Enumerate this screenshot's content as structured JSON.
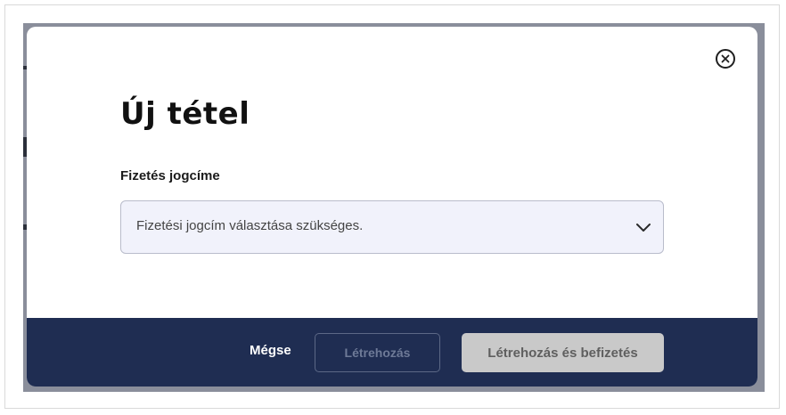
{
  "dialog": {
    "title": "Új tétel",
    "close_icon": "close-circle-icon"
  },
  "form": {
    "payment_title_label": "Fizetés jogcíme",
    "payment_title_select": {
      "placeholder": "Fizetési jogcím választása szükséges.",
      "icon": "chevron-down-icon"
    }
  },
  "footer": {
    "cancel_label": "Mégse",
    "create_label": "Létrehozás",
    "create_and_pay_label": "Létrehozás és befizetés"
  },
  "colors": {
    "footer_bg": "#1f2d52",
    "select_bg": "#f1f2fb",
    "disabled_button_bg": "#c9c9c9"
  }
}
